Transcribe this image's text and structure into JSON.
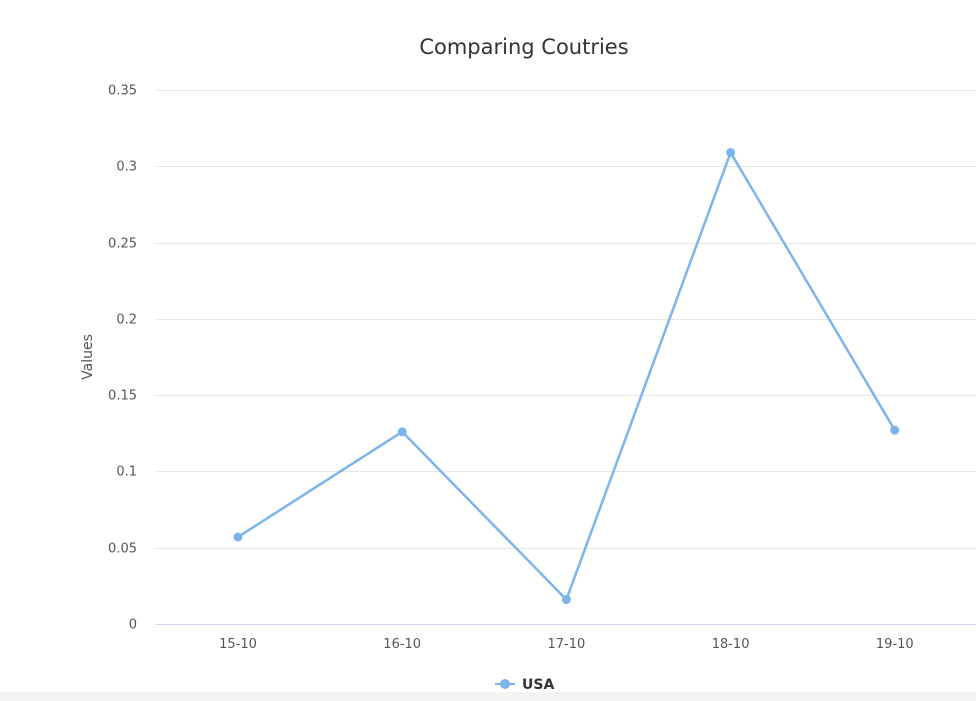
{
  "chart_data": {
    "type": "line",
    "title": "Comparing Coutries",
    "xlabel": "",
    "ylabel": "Values",
    "categories": [
      "15-10",
      "16-10",
      "17-10",
      "18-10",
      "19-10"
    ],
    "series": [
      {
        "name": "USA",
        "values": [
          0.057,
          0.126,
          0.016,
          0.309,
          0.127
        ],
        "color": "#7cb5ec"
      }
    ],
    "ylim": [
      0,
      0.35
    ],
    "yticks": [
      0,
      0.05,
      0.1,
      0.15,
      0.2,
      0.25,
      0.3,
      0.35
    ],
    "ytick_labels": [
      "0",
      "0.05",
      "0.1",
      "0.15",
      "0.2",
      "0.25",
      "0.3",
      "0.35"
    ],
    "grid": true,
    "legend_position": "bottom-center",
    "colors": {
      "grid": "#e6e6e6",
      "axis": "#ccd6eb",
      "text": "#333333",
      "tick_text": "#555555"
    }
  }
}
